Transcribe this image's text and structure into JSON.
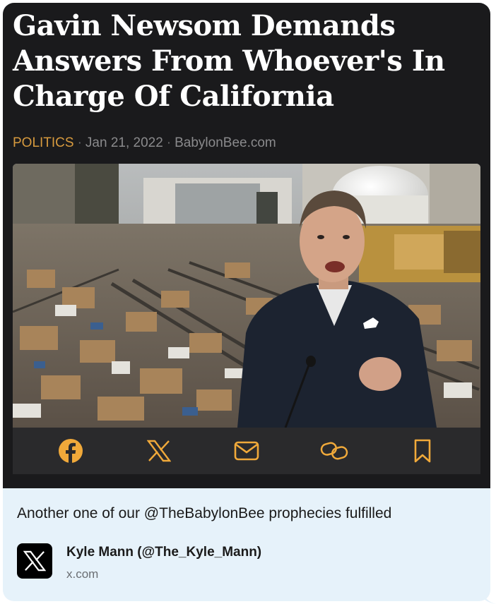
{
  "article": {
    "headline": "Gavin Newsom Demands Answers From Whoever's In Charge Of California",
    "category": "POLITICS",
    "date": "Jan 21, 2022",
    "source": "BabylonBee.com",
    "separator": "·"
  },
  "share_bar": {
    "accent_color": "#f0a93a",
    "icons": [
      "facebook-icon",
      "x-icon",
      "mail-icon",
      "link-icon",
      "bookmark-icon"
    ]
  },
  "tweet": {
    "text": "Another one of our @TheBabylonBee prophecies fulfilled",
    "author": "Kyle Mann (@The_Kyle_Mann)",
    "domain": "x.com"
  },
  "colors": {
    "article_bg": "#1a1a1c",
    "category": "#d79a3e",
    "tweet_bg": "#e6f2fa"
  }
}
